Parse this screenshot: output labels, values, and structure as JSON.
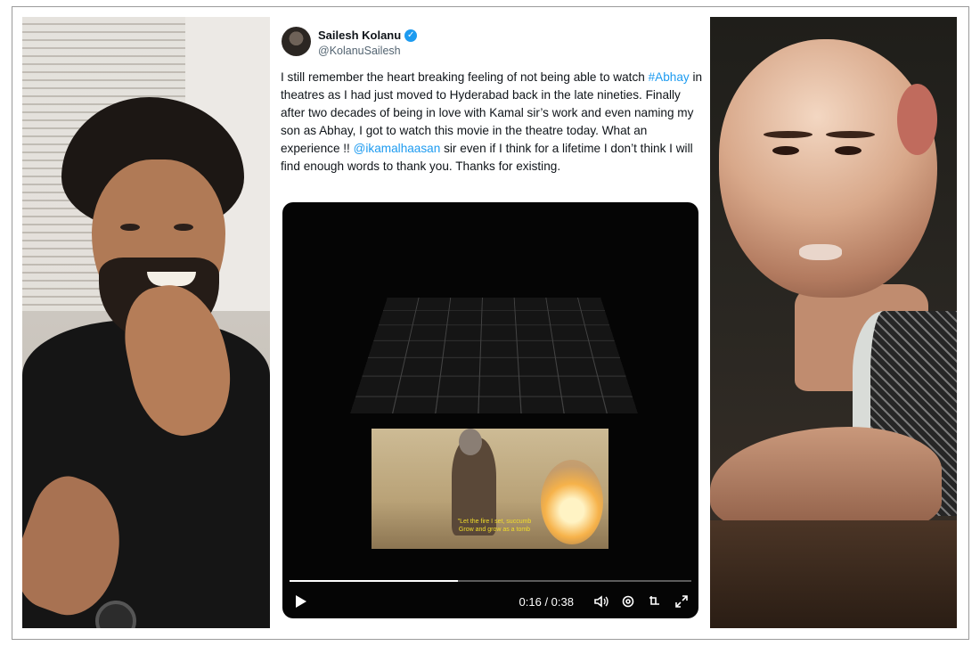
{
  "tweet": {
    "display_name": "Sailesh Kolanu",
    "handle": "@KolanuSailesh",
    "text_parts": {
      "p1": "I still remember the heart breaking feeling of not being able to watch ",
      "hashtag": "#Abhay",
      "p2": " in theatres as I had just moved to Hyderabad back in the late nineties. Finally after two decades of being in love with Kamal sir’s work and even naming my son as Abhay, I got to watch this movie in the theatre today.  What an experience !! ",
      "mention": "@ikamalhaasan",
      "p3": " sir even if I think for a lifetime I don’t think I will find enough words to thank you. Thanks for existing."
    }
  },
  "video": {
    "subtitle_line1": "\"Let the fire I set, succumb",
    "subtitle_line2": "Grow and grow as a tomb",
    "time_display": "0:16 / 0:38",
    "progress": 0.42,
    "icons": [
      "play-icon",
      "volume-icon",
      "settings-icon",
      "rotate-icon",
      "fullscreen-icon"
    ]
  },
  "colors": {
    "link": "#1d9bf0",
    "text": "#0f1419",
    "muted": "#536471",
    "video_bg": "#050505"
  }
}
